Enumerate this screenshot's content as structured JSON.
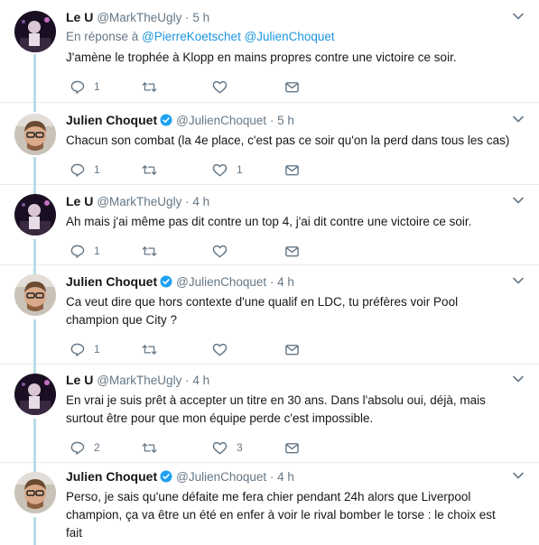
{
  "colors": {
    "link": "#1b95e0",
    "secondary": "#657786",
    "verified": "#1da1f2",
    "thread_line": "#b8dce6"
  },
  "tweets": [
    {
      "name": "Le U",
      "handle": "@MarkTheUgly",
      "time": "5 h",
      "verified": false,
      "reply_prefix": "En réponse à ",
      "reply_to": [
        "@PierreKoetschet",
        "@JulienChoquet"
      ],
      "text": "J'amène le trophée à Klopp en mains propres contre une victoire ce soir.",
      "replies": "1",
      "retweets": "",
      "likes": ""
    },
    {
      "name": "Julien Choquet",
      "handle": "@JulienChoquet",
      "time": "5 h",
      "verified": true,
      "text": "Chacun son combat (la 4e place, c'est pas ce soir qu'on la perd dans tous les cas)",
      "replies": "1",
      "retweets": "",
      "likes": "1"
    },
    {
      "name": "Le U",
      "handle": "@MarkTheUgly",
      "time": "4 h",
      "verified": false,
      "text": "Ah mais j'ai même pas dit contre un top 4, j'ai dit contre une victoire ce soir.",
      "replies": "1",
      "retweets": "",
      "likes": ""
    },
    {
      "name": "Julien Choquet",
      "handle": "@JulienChoquet",
      "time": "4 h",
      "verified": true,
      "text": "Ca veut dire que hors contexte d'une qualif en LDC, tu préfères voir Pool\nchampion que City ?",
      "replies": "1",
      "retweets": "",
      "likes": ""
    },
    {
      "name": "Le U",
      "handle": "@MarkTheUgly",
      "time": "4 h",
      "verified": false,
      "text": "En vrai je suis prêt à accepter un titre en 30 ans. Dans l'absolu oui, déjà, mais\nsurtout être pour que mon équipe perde c'est impossible.",
      "replies": "2",
      "retweets": "",
      "likes": "3"
    },
    {
      "name": "Julien Choquet",
      "handle": "@JulienChoquet",
      "time": "4 h",
      "verified": true,
      "text": "Perso, je sais qu'une défaite me fera chier pendant 24h alors que Liverpool\nchampion, ça va être un été en enfer à voir le rival bomber le torse : le choix est\nfait",
      "replies": "",
      "retweets": "",
      "likes": ""
    }
  ]
}
